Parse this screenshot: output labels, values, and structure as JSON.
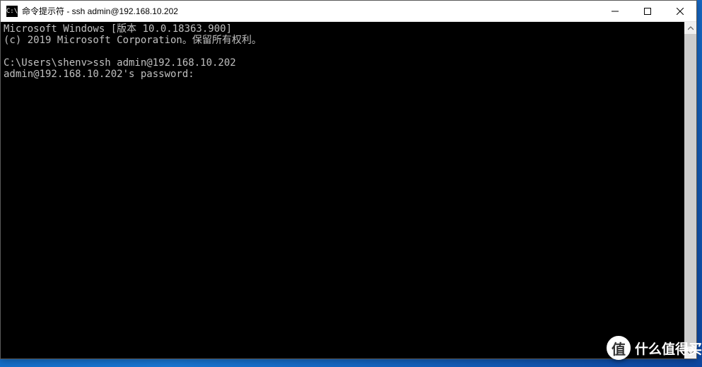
{
  "titlebar": {
    "icon_text": "C:\\",
    "title": "命令提示符 - ssh  admin@192.168.10.202"
  },
  "terminal": {
    "line1": "Microsoft Windows [版本 10.0.18363.900]",
    "line2": "(c) 2019 Microsoft Corporation。保留所有权利。",
    "line3": "",
    "line4": "C:\\Users\\shenv>ssh admin@192.168.10.202",
    "line5": "admin@192.168.10.202's password:"
  },
  "watermark": {
    "icon": "值",
    "text": "什么值得买"
  }
}
